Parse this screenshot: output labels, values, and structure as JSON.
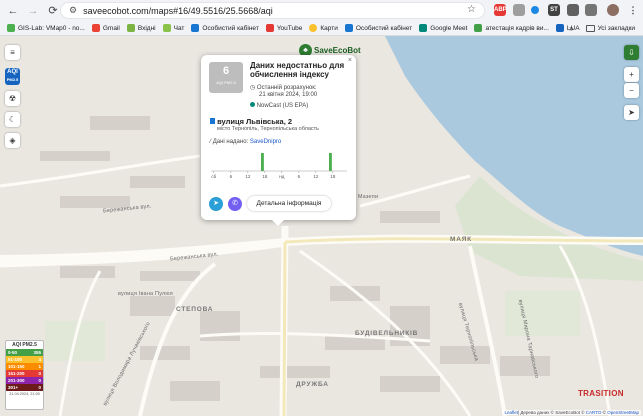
{
  "browser": {
    "url": "saveecobot.com/maps#16/49.5516/25.5668/aqi",
    "bookmarks": [
      {
        "label": "GIS-Lab: VMap0 - no...",
        "color": "#4caf50"
      },
      {
        "label": "Gmail",
        "color": "#ea4335"
      },
      {
        "label": "Вхідні",
        "color": "#7cb342"
      },
      {
        "label": "Чат",
        "color": "#8bc34a"
      },
      {
        "label": "Особистий кабінет",
        "color": "#1976d2"
      },
      {
        "label": "YouTube",
        "color": "#e53935"
      },
      {
        "label": "Карти",
        "color": "#fbc02d"
      },
      {
        "label": "Особистий кабінет",
        "color": "#1976d2"
      },
      {
        "label": "Google Meet",
        "color": "#00897b"
      },
      {
        "label": "атестація кадрів ви...",
        "color": "#43a047"
      },
      {
        "label": "LUA",
        "color": "#1565c0"
      }
    ],
    "all_bookmarks": "Усі закладки"
  },
  "map": {
    "controls": {
      "menu": "≡",
      "aqi_title": "AQI",
      "aqi_sub": "PM2.5",
      "zoom_in": "+",
      "zoom_out": "−"
    },
    "streets": [
      {
        "name": "вул. Гетьмана Мазепи"
      },
      {
        "name": "Бережанська вул."
      },
      {
        "name": "Бережанська вул."
      },
      {
        "name": "вулиця Івана Пулюя"
      },
      {
        "name": "вулиця Володимира Лучаківського"
      },
      {
        "name": "вулиця Тернопільська"
      },
      {
        "name": "вулиця Мирона Тарнавського"
      }
    ],
    "districts": {
      "mayak": "МАЯК",
      "stepova": "СТЕПОВА",
      "budivelnykiv": "БУДІВЕЛЬНИКІВ",
      "druzhba": "ДРУЖБА"
    }
  },
  "popup": {
    "brand": "SaveEcoBot",
    "aqi_value": "6",
    "aqi_label": "AQI PM2.5",
    "title": "Даних недостатньо для обчислення індексу",
    "last_calc_label": "Останній розрахунок:",
    "last_calc_time": "21 квітня 2024, 19:00",
    "nowcast": "NowCast (US EPA)",
    "address": "вулиця Львівська, 2",
    "city": "місто Тернопіль, Тернопільська область",
    "data_by_label": "Дані надано:",
    "data_by_source": "SaveDnipro",
    "chart_ticks": [
      "сб",
      "6",
      "12",
      "18",
      "нд",
      "6",
      "12",
      "18"
    ],
    "detail_button": "Детальна інформація",
    "close": "×"
  },
  "legend": {
    "title": "AQI PM2.5",
    "rows": [
      {
        "range": "0-50",
        "count": "355",
        "color": "#43a047"
      },
      {
        "range": "51-100",
        "count": "4",
        "color": "#fbc02d"
      },
      {
        "range": "101-150",
        "count": "1",
        "color": "#fb8c00"
      },
      {
        "range": "151-200",
        "count": "0",
        "color": "#e53935"
      },
      {
        "range": "201-300",
        "count": "0",
        "color": "#8e24aa"
      },
      {
        "range": "301+",
        "count": "0",
        "color": "#6d1a1a"
      }
    ],
    "footer": "21.04.2024, 21:00"
  },
  "watermark": "TRASITION",
  "attribution": {
    "leaflet": "Leaflet",
    "middle": "| Дерева даних © SaveEcoBot © ",
    "carto": "CARTO",
    "osm_pre": " © ",
    "osm": "OpenStreetMap"
  },
  "chart_data": {
    "type": "bar",
    "categories": [
      "сб",
      "6",
      "12",
      "18",
      "нд",
      "6",
      "12",
      "18"
    ],
    "bars": [
      {
        "x": 18.0,
        "value": 1.0
      },
      {
        "x": 18.3,
        "value": 1.0
      },
      {
        "x": 42.0,
        "value": 1.0
      },
      {
        "x": 42.3,
        "value": 1.0
      }
    ],
    "xlim": [
      0,
      48
    ],
    "ylim": [
      0,
      1
    ],
    "bar_color": "#4caf50"
  }
}
